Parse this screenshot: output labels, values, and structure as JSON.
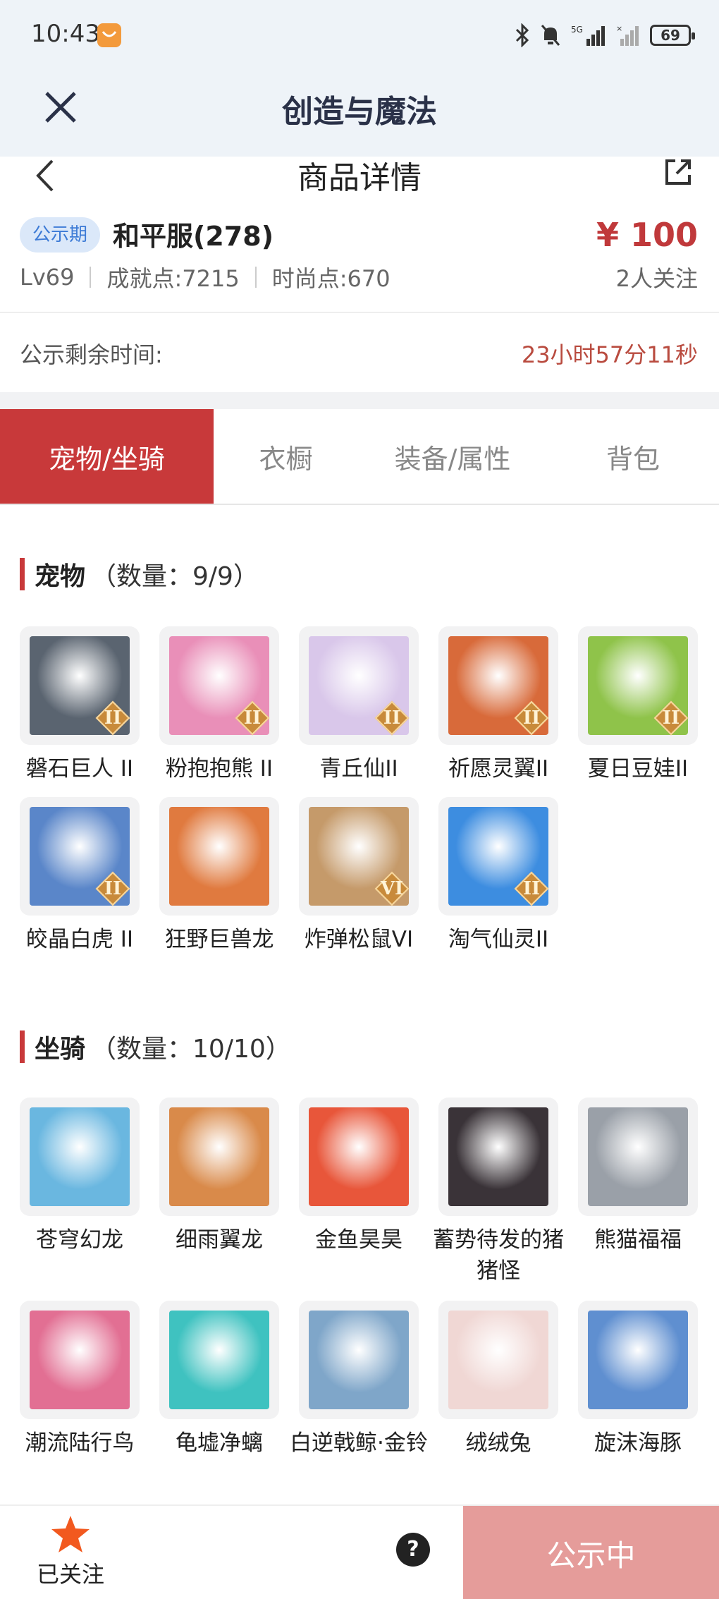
{
  "status_bar": {
    "time": "10:43",
    "battery": "69",
    "icons": [
      "bluetooth-icon",
      "mute-icon",
      "signal-5g-icon",
      "signal-icon",
      "battery-icon"
    ]
  },
  "app_header": {
    "title": "创造与魔法",
    "close_icon": "close-icon"
  },
  "sub_header": {
    "title": "商品详情",
    "back_icon": "back-icon",
    "share_icon": "share-icon"
  },
  "product": {
    "tag": "公示期",
    "server": "和平服(278)",
    "price": "¥ 100",
    "level": "Lv69",
    "achievement": "成就点:7215",
    "fashion": "时尚点:670",
    "followers": "2人关注"
  },
  "timer": {
    "label": "公示剩余时间:",
    "value": "23小时57分11秒"
  },
  "tabs": [
    "宠物/坐骑",
    "衣橱",
    "装备/属性",
    "背包"
  ],
  "active_tab": 0,
  "pets": {
    "title": "宠物",
    "count": "（数量：9/9）",
    "items": [
      {
        "name": "磐石巨人 II",
        "level": "II",
        "color": "#5a6470"
      },
      {
        "name": "粉抱抱熊 II",
        "level": "II",
        "color": "#e98fb8"
      },
      {
        "name": "青丘仙II",
        "level": "II",
        "color": "#d9c7ea"
      },
      {
        "name": "祈愿灵翼II",
        "level": "II",
        "color": "#d86a3a"
      },
      {
        "name": "夏日豆娃II",
        "level": "II",
        "color": "#8fc34a"
      },
      {
        "name": "皎晶白虎 II",
        "level": "II",
        "color": "#5a86c9"
      },
      {
        "name": "狂野巨兽龙",
        "level": "",
        "color": "#e07a3f"
      },
      {
        "name": "炸弹松鼠VI",
        "level": "VI",
        "color": "#c59a6a"
      },
      {
        "name": "淘气仙灵II",
        "level": "II",
        "color": "#3d8de0"
      }
    ]
  },
  "mounts": {
    "title": "坐骑",
    "count": "（数量：10/10）",
    "items": [
      {
        "name": "苍穹幻龙",
        "color": "#6ab7e0"
      },
      {
        "name": "细雨翼龙",
        "color": "#d98a4a"
      },
      {
        "name": "金鱼昊昊",
        "color": "#e8563a"
      },
      {
        "name": "蓄势待发的猪猪怪",
        "color": "#3a3338"
      },
      {
        "name": "熊猫福福",
        "color": "#9aa0a8"
      },
      {
        "name": "潮流陆行鸟",
        "color": "#e26f93"
      },
      {
        "name": "龟墟净螭",
        "color": "#3fc2c0"
      },
      {
        "name": "白逆戟鲸·金铃",
        "color": "#7fa6c9"
      },
      {
        "name": "绒绒兔",
        "color": "#f0d7d4"
      },
      {
        "name": "旋沫海豚",
        "color": "#5f8fd0"
      }
    ]
  },
  "bottom": {
    "follow_label": "已关注",
    "help": "?",
    "status_button": "公示中"
  },
  "colors": {
    "accent": "#c8393a",
    "price": "#c0393b",
    "tag_bg": "#dbe8f9",
    "tag_text": "#3d7bd6",
    "status_btn": "#e59c9a"
  }
}
